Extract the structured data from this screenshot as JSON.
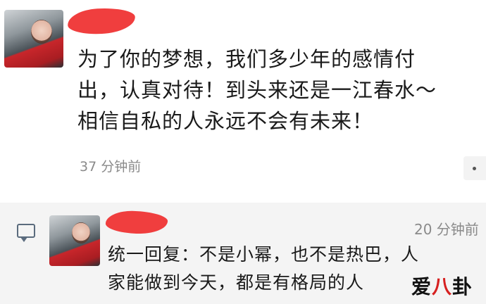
{
  "post": {
    "lines": [
      "为了你的梦想，我们多少年的感情付",
      "出，认真对待！到头来还是一江春水～",
      "相信自私的人永远不会有未来！"
    ],
    "timestamp": "37 分钟前",
    "more_icon": "ellipsis-icon"
  },
  "comment": {
    "icon": "comment-bubble-icon",
    "time": "20 分钟前",
    "lines": [
      "统一回复：不是小幂，也不是热巴，人",
      "家能做到今天，都是有格局的人"
    ]
  },
  "watermark": {
    "part1": "爱",
    "part2": "八",
    "part3": "卦"
  },
  "colors": {
    "redaction": "#ef2e2e",
    "comment_bg": "#f4f4f4",
    "timestamp_gray": "#8a8a8a"
  }
}
